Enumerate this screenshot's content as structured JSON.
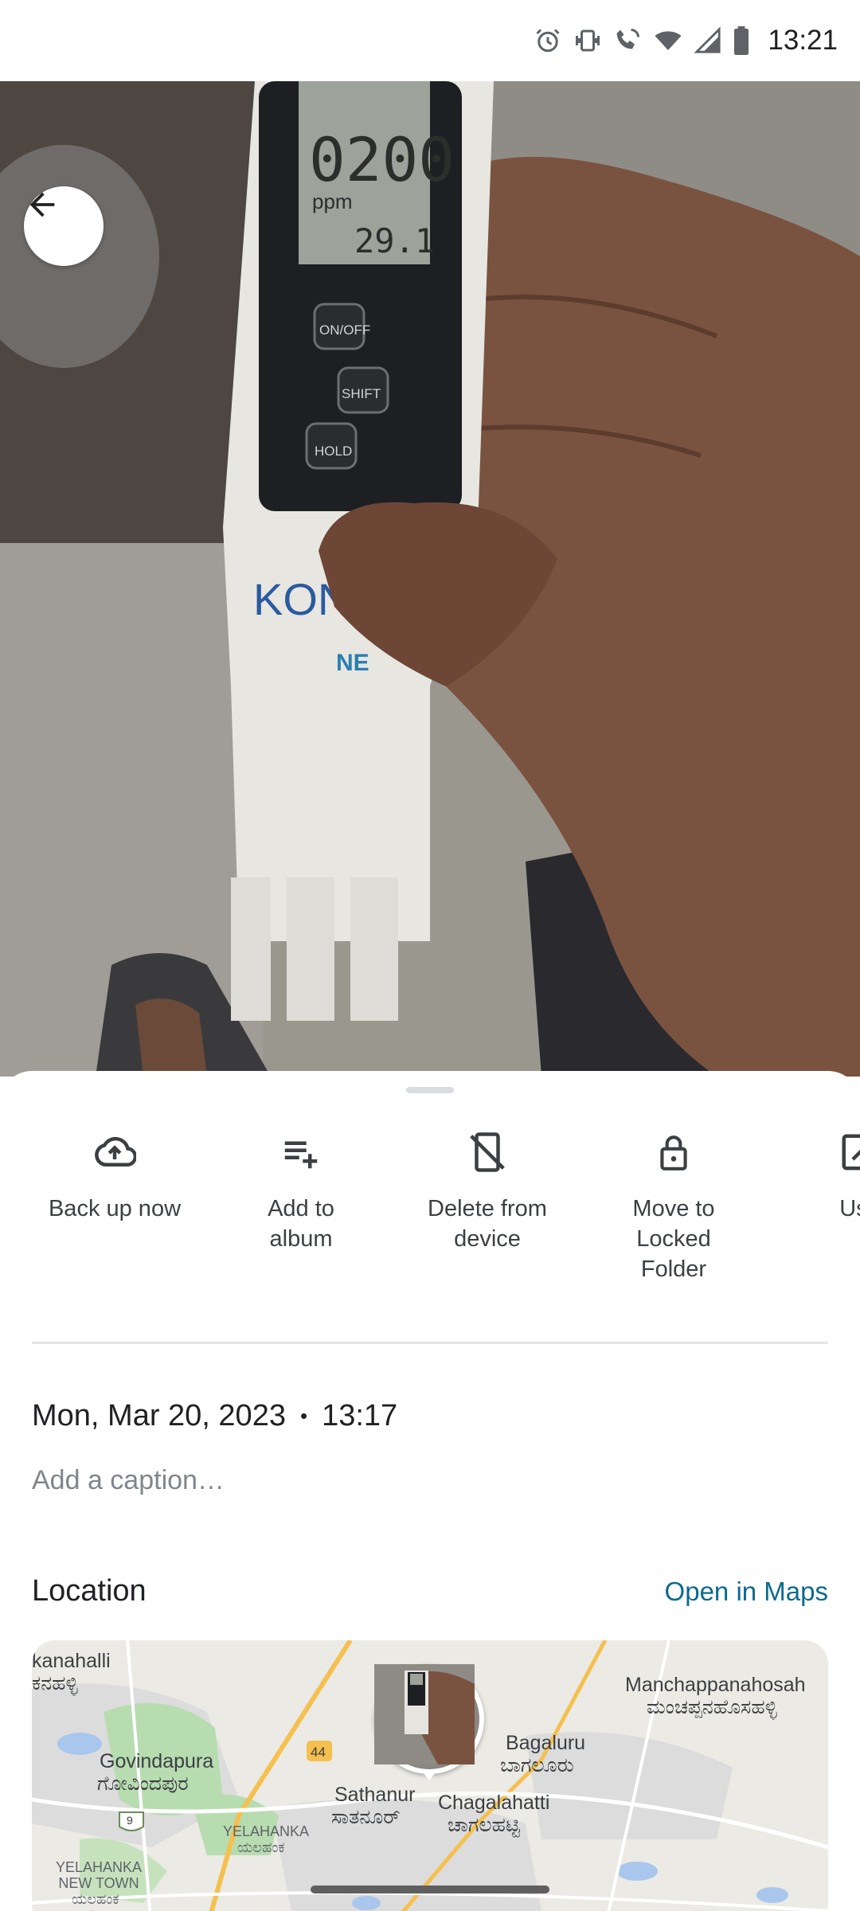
{
  "status_bar": {
    "time": "13:21",
    "icons": [
      "alarm-icon",
      "vibrate-icon",
      "wifi-calling-icon",
      "wifi-icon",
      "signal-icon",
      "battery-icon"
    ]
  },
  "photo": {
    "meter_reading": "0200",
    "meter_unit": "ppm",
    "meter_temp": "29.1",
    "buttons": [
      "ON/OFF",
      "SHIFT",
      "HOLD"
    ],
    "brand": "KON",
    "brand_sub": "NE"
  },
  "actions": [
    {
      "label": "Back up now",
      "icon": "cloud-upload-icon"
    },
    {
      "label": "Add to\nalbum",
      "icon": "playlist-add-icon"
    },
    {
      "label": "Delete from\ndevice",
      "icon": "phone-delete-icon"
    },
    {
      "label": "Move to\nLocked\nFolder",
      "icon": "lock-icon"
    },
    {
      "label": "Use",
      "icon": "edit-icon"
    }
  ],
  "details": {
    "date": "Mon, Mar 20, 2023",
    "time": "13:17",
    "caption_placeholder": "Add a caption…"
  },
  "location": {
    "title": "Location",
    "open_maps": "Open in Maps",
    "map_labels": {
      "kanahalli": "kanahalli",
      "kanahalli_kn": "ಕನಹಳ್ಳಿ",
      "govindapura": "Govindapura",
      "govindapura_kn": "ಗೋವಿಂದಪುರ",
      "sathanur": "Sathanur",
      "sathanur_kn": "ಸಾತನೂರ್",
      "bagaluru": "Bagaluru",
      "bagaluru_kn": "ಬಾಗಲೂರು",
      "chagalahatti": "Chagalahatti",
      "chagalahatti_kn": "ಚಾಗಲಹಟ್ಟಿ",
      "manchappanahosah": "Manchappanahosah",
      "manchappanahosah_kn": "ಮಂಚಪ್ಪನಹೊಸಹಳ್ಳಿ",
      "yelahanka": "YELAHANKA",
      "yelahanka_kn": "ಯಲಹಂಕ",
      "yelahanka_new_town": "YELAHANKA\nNEW TOWN",
      "yelahanka_new_town_kn": "ಯಲಹಂಕ\nನ್ಯೂ",
      "road_44": "44",
      "road_9": "9"
    }
  }
}
